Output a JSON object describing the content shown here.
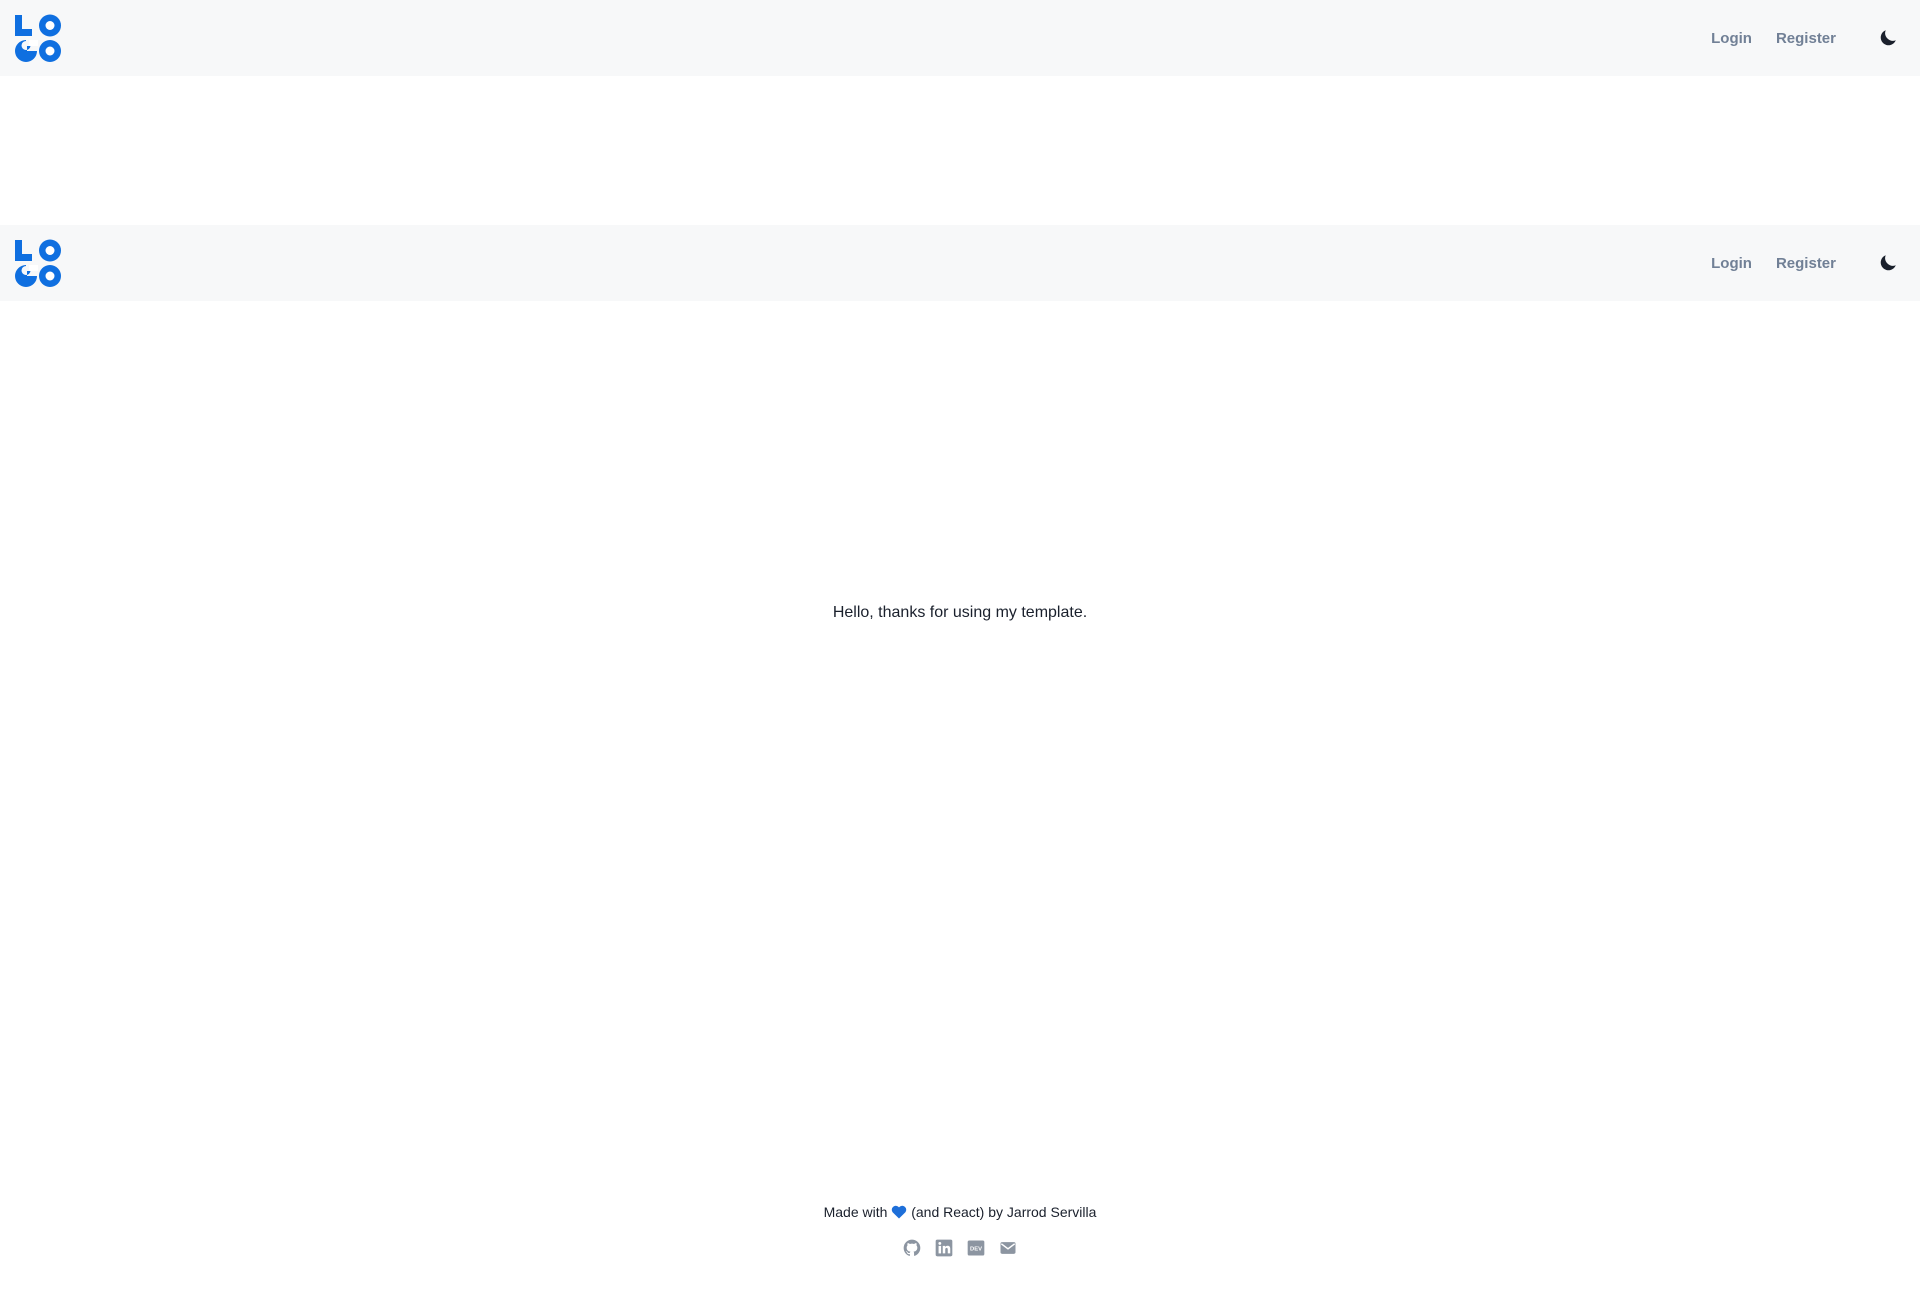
{
  "colors": {
    "brand": "#0f6fe0",
    "nav_bg": "#f7f8f9",
    "nav_text": "#718096",
    "icon_gray": "#8c95a1",
    "heart": "#1e6fd9"
  },
  "logo": {
    "icon": "logo-icon"
  },
  "nav": {
    "login": "Login",
    "register": "Register",
    "theme_icon": "moon-icon"
  },
  "main": {
    "message": "Hello, thanks for using my template."
  },
  "footer": {
    "text_before": "Made with",
    "heart_icon": "heart-icon",
    "text_after": "(and React) by Jarrod Servilla",
    "socials": [
      "github-icon",
      "linkedin-icon",
      "dev-icon",
      "mail-icon"
    ]
  }
}
